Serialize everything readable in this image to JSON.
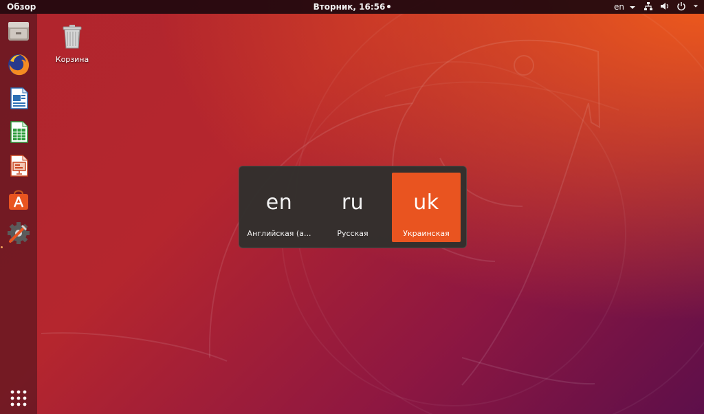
{
  "topbar": {
    "activities": "Обзор",
    "clock": "Вторник, 16:56",
    "language": "en",
    "tray_icons": [
      "network-icon",
      "volume-icon",
      "power-icon"
    ]
  },
  "dock": {
    "items": [
      {
        "name": "files-app-icon",
        "running": false
      },
      {
        "name": "firefox-app-icon",
        "running": false
      },
      {
        "name": "writer-app-icon",
        "running": false
      },
      {
        "name": "calc-app-icon",
        "running": false
      },
      {
        "name": "impress-app-icon",
        "running": false
      },
      {
        "name": "software-app-icon",
        "running": false
      },
      {
        "name": "settings-app-icon",
        "running": true
      }
    ],
    "show_apps_icon": "grid-icon"
  },
  "desktop": {
    "trash_label": "Корзина"
  },
  "switcher": {
    "layouts": [
      {
        "code": "en",
        "name": "Английская (а...",
        "selected": false
      },
      {
        "code": "ru",
        "name": "Русская",
        "selected": false
      },
      {
        "code": "uk",
        "name": "Украинская",
        "selected": true
      }
    ]
  },
  "colors": {
    "accent": "#e95420",
    "topbar": "#1e080e",
    "switcher_bg": "#30302d"
  }
}
